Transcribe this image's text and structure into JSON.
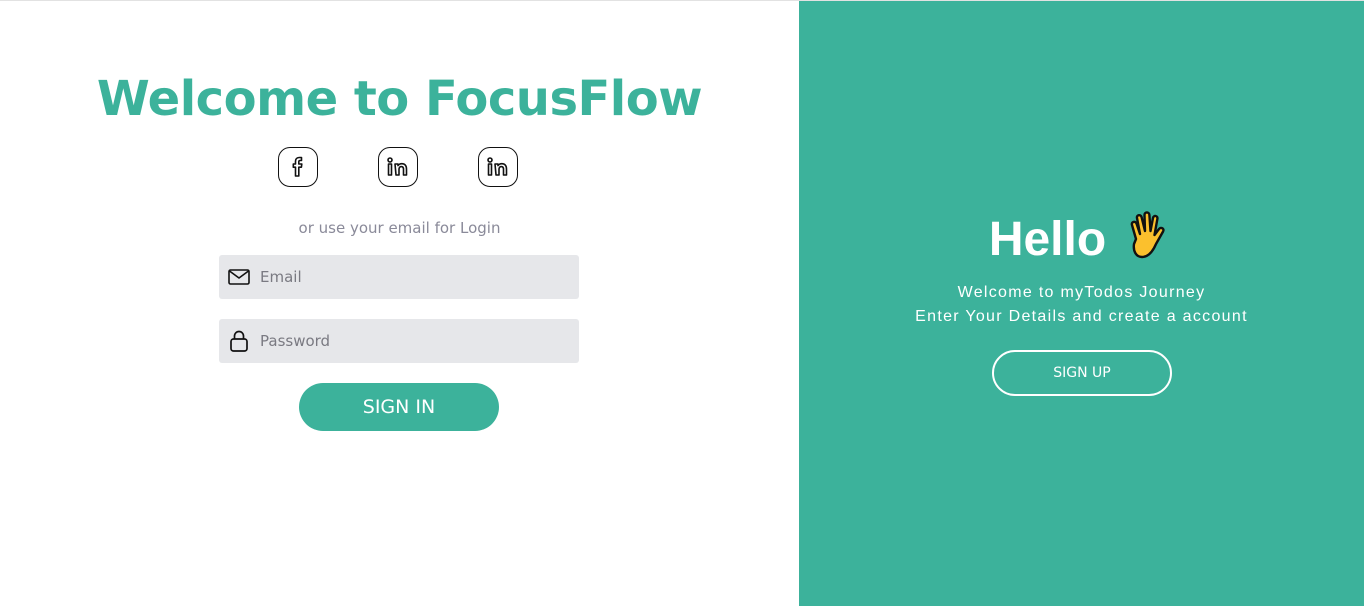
{
  "login": {
    "title": "Welcome to FocusFlow",
    "social_icons": [
      "facebook-icon",
      "linkedin-icon",
      "linkedin-icon"
    ],
    "hint": "or use your email for Login",
    "email": {
      "placeholder": "Email",
      "value": "",
      "icon": "envelope-icon"
    },
    "password": {
      "placeholder": "Password",
      "value": "",
      "icon": "lock-icon"
    },
    "signin_label": "SIGN IN"
  },
  "panel": {
    "hello": "Hello",
    "wave_icon": "waving-hand-icon",
    "line1": "Welcome to myTodos Journey",
    "line2": "Enter Your Details and create a account",
    "signup_label": "SIGN UP"
  },
  "colors": {
    "accent": "#3cb29b",
    "input_bg": "#e6e7ea",
    "hint_text": "#8a8a99"
  }
}
